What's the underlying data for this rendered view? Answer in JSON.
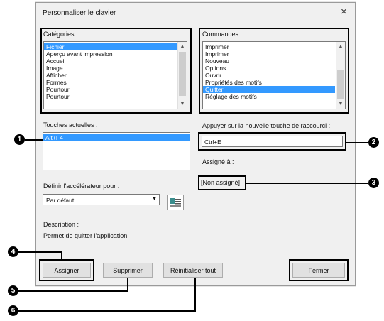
{
  "window": {
    "title": "Personnaliser le clavier",
    "close_glyph": "×"
  },
  "categories": {
    "label": "Catégories :",
    "items": [
      "Fichier",
      "Aperçu avant impression",
      "Accueil",
      "Image",
      "Afficher",
      "Formes",
      "Pourtour",
      "Pourtour"
    ]
  },
  "commands": {
    "label": "Commandes :",
    "items": [
      "Imprimer",
      "Imprimer",
      "Nouveau",
      "Options",
      "Ouvrir",
      "Propriétés des motifs",
      "Quitter",
      "Réglage des motifs"
    ]
  },
  "current_keys": {
    "label": "Touches actuelles :",
    "items": [
      "Alt+F4"
    ]
  },
  "new_shortcut": {
    "label": "Appuyer sur la nouvelle touche de raccourci :",
    "value": "Ctrl+E"
  },
  "assigned": {
    "label": "Assigné à :",
    "value": "[Non assigné]"
  },
  "accelerator": {
    "label": "Définir l'accélérateur pour :",
    "value": "Par défaut"
  },
  "description": {
    "label": "Description :",
    "text": "Permet de quitter l'application."
  },
  "buttons": {
    "assign": "Assigner",
    "delete": "Supprimer",
    "reset": "Réinitialiser tout",
    "close": "Fermer"
  },
  "markers": [
    "1",
    "2",
    "3",
    "4",
    "5",
    "6"
  ],
  "colors": {
    "selection": "#3399ff",
    "dialog_bg": "#f0f0f0",
    "marker": "#000000"
  }
}
